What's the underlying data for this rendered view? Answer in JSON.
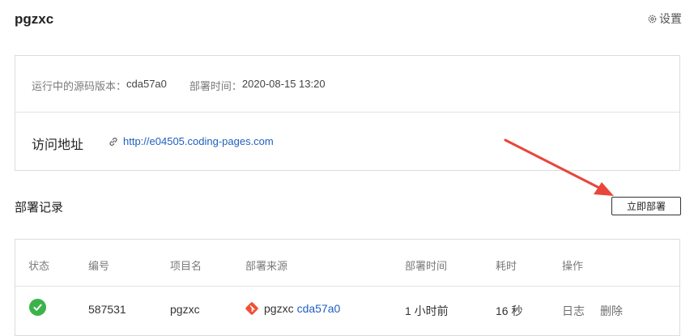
{
  "header": {
    "title": "pgzxc",
    "settings_label": "设置"
  },
  "info": {
    "version_label": "运行中的源码版本：",
    "version_value": "cda57a0",
    "deploy_time_label": "部署时间：",
    "deploy_time_value": "2020-08-15 13:20",
    "visit_label": "访问地址",
    "visit_url": "http://e04505.coding-pages.com"
  },
  "records": {
    "title": "部署记录",
    "deploy_button": "立即部署",
    "columns": [
      "状态",
      "编号",
      "项目名",
      "部署来源",
      "部署时间",
      "耗时",
      "操作"
    ],
    "rows": [
      {
        "status": "success",
        "id": "587531",
        "project": "pgzxc",
        "source_repo": "pgzxc",
        "source_commit": "cda57a0",
        "deploy_time": "1 小时前",
        "duration": "16 秒",
        "action_log": "日志",
        "action_delete": "删除"
      }
    ]
  },
  "colors": {
    "accent_link": "#1f5fbf",
    "success": "#3cb34a",
    "git": "#f05133",
    "annotation_arrow": "#e8463a"
  }
}
